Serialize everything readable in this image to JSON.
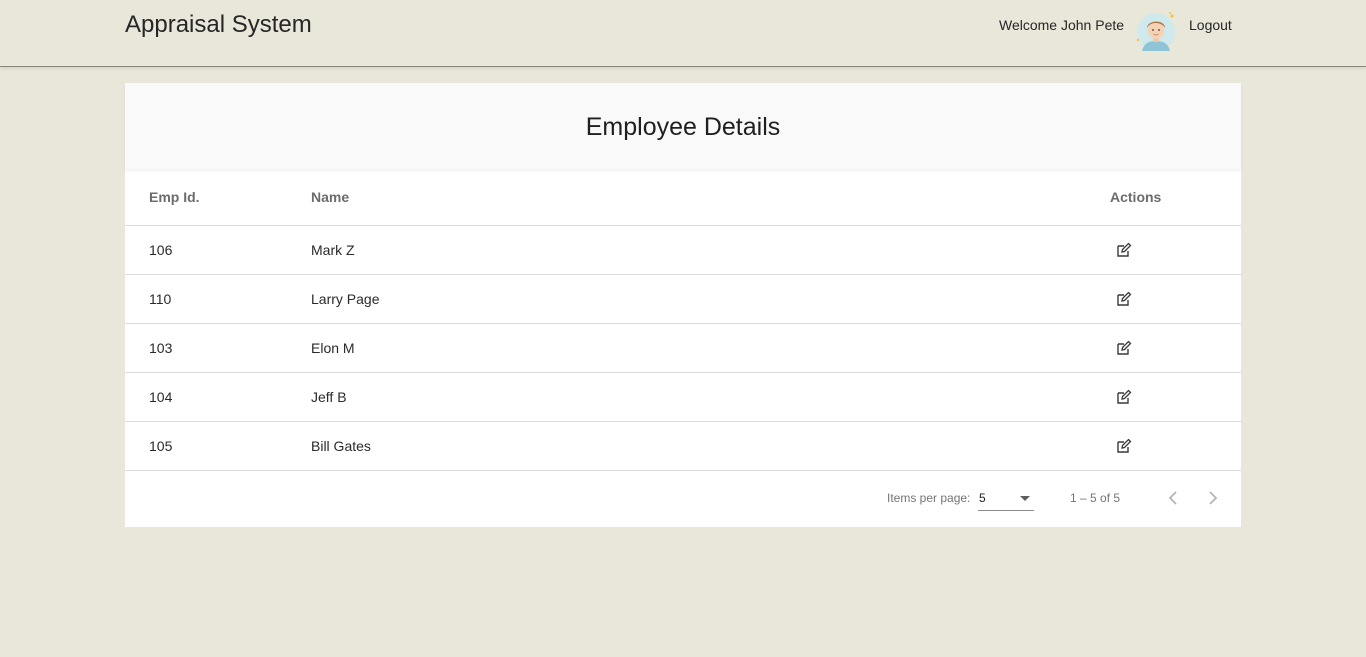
{
  "header": {
    "app_title": "Appraisal System",
    "welcome_text": "Welcome John Pete",
    "logout_label": "Logout",
    "avatar_icon": "user-avatar-icon"
  },
  "card": {
    "title": "Employee Details",
    "columns": {
      "emp_id": "Emp Id.",
      "name": "Name",
      "actions": "Actions"
    },
    "rows": [
      {
        "emp_id": "106",
        "name": "Mark Z",
        "action_icon": "edit-icon"
      },
      {
        "emp_id": "110",
        "name": "Larry Page",
        "action_icon": "edit-icon"
      },
      {
        "emp_id": "103",
        "name": "Elon M",
        "action_icon": "edit-icon"
      },
      {
        "emp_id": "104",
        "name": "Jeff B",
        "action_icon": "edit-icon"
      },
      {
        "emp_id": "105",
        "name": "Bill Gates",
        "action_icon": "edit-icon"
      }
    ]
  },
  "paginator": {
    "items_per_page_label": "Items per page:",
    "items_per_page_value": "5",
    "range_label": "1 – 5 of 5",
    "prev_icon": "chevron-left-icon",
    "next_icon": "chevron-right-icon"
  },
  "colors": {
    "background": "#e9e6da",
    "card": "#ffffff",
    "card_header": "#f9f9f9",
    "divider": "#dcdcdc"
  }
}
